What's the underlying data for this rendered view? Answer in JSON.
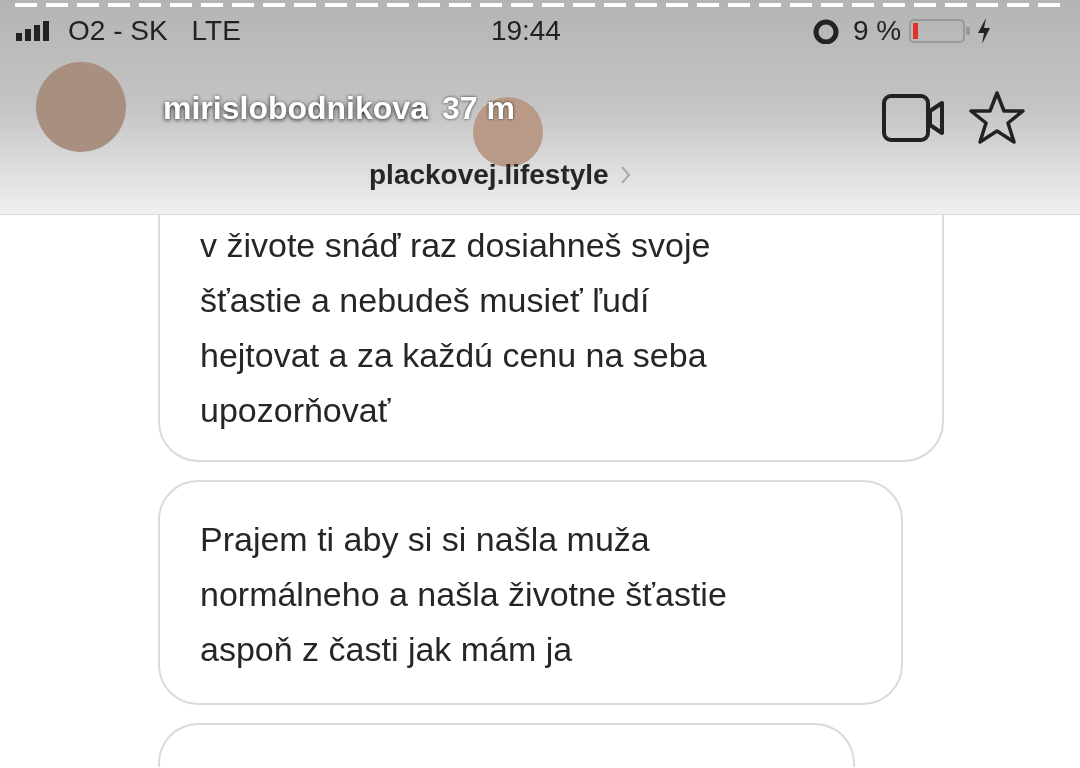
{
  "status_bar": {
    "carrier": "O2 - SK",
    "network": "LTE",
    "time": "19:44",
    "battery": "9 %"
  },
  "story_header": {
    "username": "mirislobodnikova",
    "age": "37 m",
    "shared_from": "plackovej.lifestyle"
  },
  "messages": [
    {
      "text": "v živote snáď raz dosiahneš svoje\nšťastie a nebudeš musieť ľudí\nhejtovat a za každú cenu na seba\nupozorňovať",
      "cut_top": true
    },
    {
      "text": "Prajem ti aby si si našla muža\nnormálneho a našla životne šťastie\naspoň z časti jak mám ja",
      "cut_top": false
    }
  ]
}
